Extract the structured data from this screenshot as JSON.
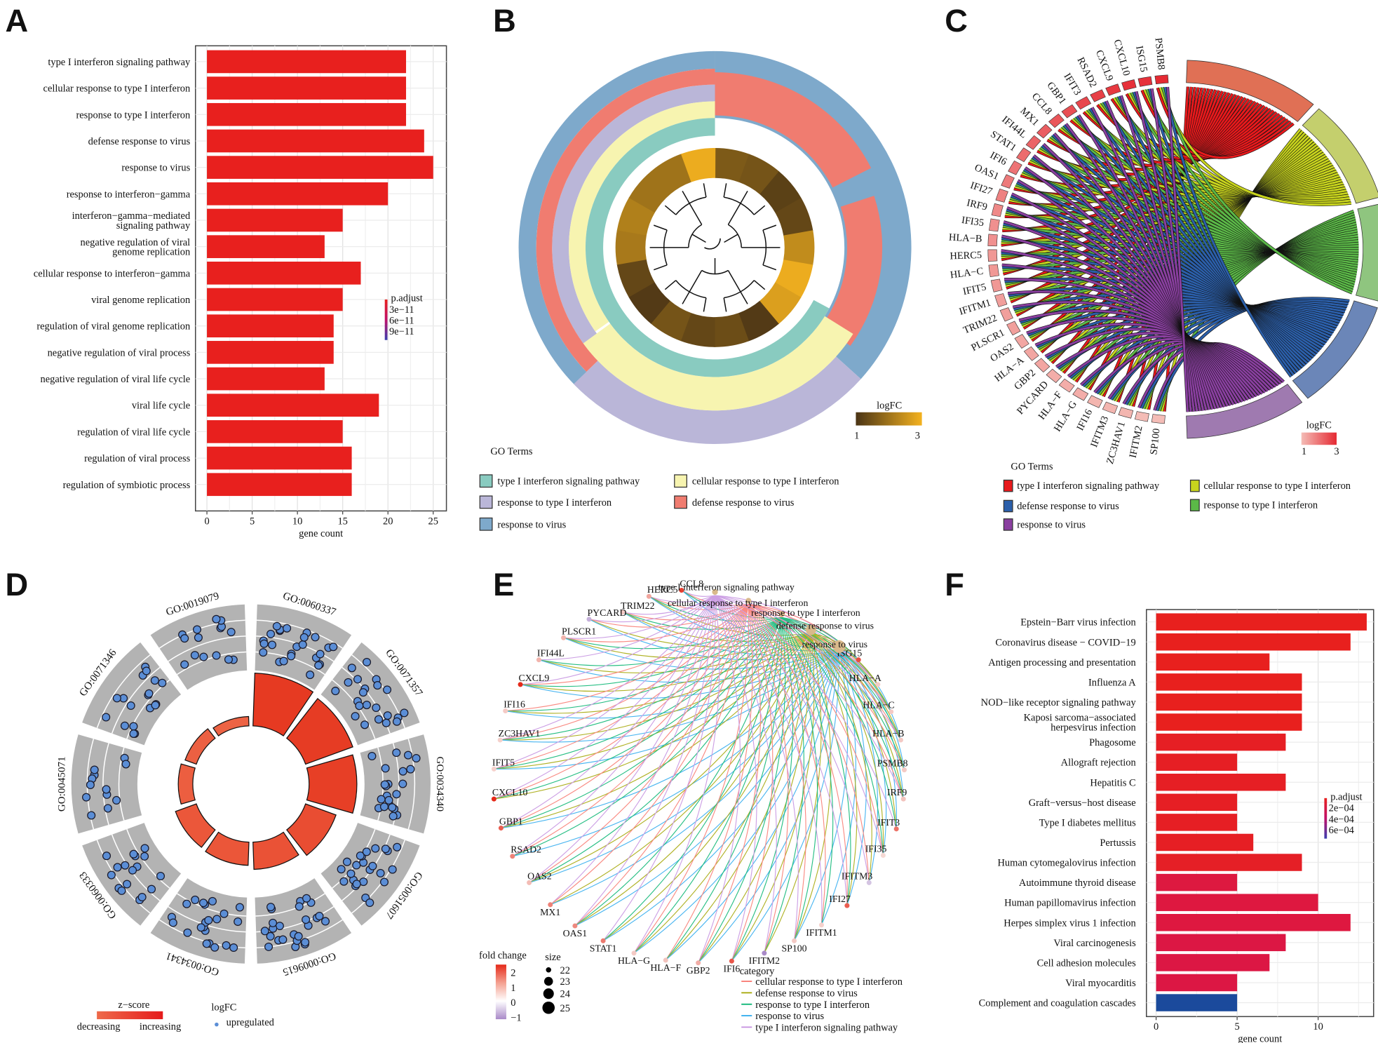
{
  "figure": {
    "panel_labels": [
      "A",
      "B",
      "C",
      "D",
      "E",
      "F"
    ]
  },
  "chart_data": [
    {
      "panel": "A",
      "type": "bar",
      "orientation": "horizontal",
      "categories": [
        "type I interferon signaling pathway",
        "cellular response to type I interferon",
        "response to type I interferon",
        "defense response to virus",
        "response to virus",
        "response to interferon−gamma",
        "interferon−gamma−mediated\nsignaling pathway",
        "negative regulation of viral\ngenome replication",
        "cellular response to interferon−gamma",
        "viral genome replication",
        "regulation of viral genome replication",
        "negative regulation of viral process",
        "negative regulation of viral life cycle",
        "viral life cycle",
        "regulation of viral life cycle",
        "regulation of viral process",
        "regulation of symbiotic process"
      ],
      "values": [
        22,
        22,
        22,
        24,
        25,
        20,
        15,
        13,
        17,
        15,
        14,
        14,
        13,
        19,
        15,
        16,
        16
      ],
      "bar_colors": [
        "#e8201e"
      ],
      "xlabel": "gene count",
      "xlim": [
        0,
        26
      ],
      "xticks": [
        "0",
        "5",
        "10",
        "15",
        "20",
        "25"
      ],
      "grid": true,
      "legend": {
        "title": "p.adjust",
        "labels": [
          "3e−11",
          "6e−11",
          "9e−11"
        ],
        "low_color": "#e8201e",
        "high_color": "#3a3fb0",
        "placement": "right"
      }
    },
    {
      "panel": "B",
      "type": "heatmap",
      "legend_title": "GO Terms",
      "terms": [
        {
          "name": "type I interferon signaling pathway",
          "color": "#89cbc0"
        },
        {
          "name": "cellular response to type I interferon",
          "color": "#f7f4b0"
        },
        {
          "name": "response to type I interferon",
          "color": "#bab6d8"
        },
        {
          "name": "defense response to virus",
          "color": "#f07c70"
        },
        {
          "name": "response to virus",
          "color": "#7ea9cb"
        }
      ],
      "colorbar": {
        "title": "logFC",
        "min_label": "1",
        "max_label": "3",
        "low_color": "#4a3415",
        "high_color": "#f4b21f"
      },
      "logfc_ring": [
        1.6,
        1.5,
        1.2,
        1.3,
        2.4,
        2.9,
        2.7,
        1.1,
        1.4,
        1.3,
        1.5,
        1.1,
        1.3,
        2.1,
        2.2,
        2.0,
        2.0,
        2.9
      ]
    },
    {
      "panel": "C",
      "type": "chord",
      "genes": [
        {
          "name": "SP100",
          "logfc": 1.0
        },
        {
          "name": "IFITM2",
          "logfc": 1.0
        },
        {
          "name": "ZC3HAV1",
          "logfc": 1.1
        },
        {
          "name": "IFITM3",
          "logfc": 1.1
        },
        {
          "name": "IFI16",
          "logfc": 1.1
        },
        {
          "name": "HLA−G",
          "logfc": 1.2
        },
        {
          "name": "HLA−F",
          "logfc": 1.2
        },
        {
          "name": "PYCARD",
          "logfc": 1.2
        },
        {
          "name": "GBP2",
          "logfc": 1.3
        },
        {
          "name": "HLA−A",
          "logfc": 1.3
        },
        {
          "name": "OAS2",
          "logfc": 1.3
        },
        {
          "name": "PLSCR1",
          "logfc": 1.4
        },
        {
          "name": "TRIM22",
          "logfc": 1.4
        },
        {
          "name": "IFITM1",
          "logfc": 1.4
        },
        {
          "name": "IFIT5",
          "logfc": 1.5
        },
        {
          "name": "HLA−C",
          "logfc": 1.5
        },
        {
          "name": "HERC5",
          "logfc": 1.5
        },
        {
          "name": "HLA−B",
          "logfc": 1.6
        },
        {
          "name": "IFI35",
          "logfc": 1.6
        },
        {
          "name": "IRF9",
          "logfc": 1.7
        },
        {
          "name": "IFI27",
          "logfc": 1.8
        },
        {
          "name": "OAS1",
          "logfc": 1.9
        },
        {
          "name": "IFI6",
          "logfc": 2.0
        },
        {
          "name": "STAT1",
          "logfc": 2.1
        },
        {
          "name": "IFI44L",
          "logfc": 2.2
        },
        {
          "name": "MX1",
          "logfc": 2.3
        },
        {
          "name": "CCL8",
          "logfc": 2.4
        },
        {
          "name": "GBP1",
          "logfc": 2.5
        },
        {
          "name": "IFIT3",
          "logfc": 2.6
        },
        {
          "name": "RSAD2",
          "logfc": 2.7
        },
        {
          "name": "CXCL9",
          "logfc": 2.8
        },
        {
          "name": "CXCL10",
          "logfc": 2.9
        },
        {
          "name": "ISG15",
          "logfc": 2.9
        },
        {
          "name": "PSMB8",
          "logfc": 3.0
        }
      ],
      "terms": [
        {
          "name": "type I interferon signaling pathway",
          "color": "#e8191c",
          "band_color": "#e07055"
        },
        {
          "name": "cellular response to type I interferon",
          "color": "#c8d41d",
          "band_color": "#c4cf6d"
        },
        {
          "name": "response to type I interferon",
          "color": "#5bb947",
          "band_color": "#8fc57f"
        },
        {
          "name": "defense response to virus",
          "color": "#2b5faa",
          "band_color": "#6b86b8"
        },
        {
          "name": "response to virus",
          "color": "#8a3fa0",
          "band_color": "#9f7ab0"
        }
      ],
      "legend_title": "GO Terms",
      "colorbar": {
        "title": "logFC",
        "min_label": "1",
        "max_label": "3",
        "low_color": "#f4bcb6",
        "high_color": "#e52a33"
      }
    },
    {
      "panel": "D",
      "type": "bar",
      "layout": "circular",
      "terms": [
        {
          "id": "GO:0060337",
          "bar_fraction": 1.0,
          "dots": 25
        },
        {
          "id": "GO:0071357",
          "bar_fraction": 0.95,
          "dots": 22
        },
        {
          "id": "GO:0034340",
          "bar_fraction": 0.9,
          "dots": 22
        },
        {
          "id": "GO:0051607",
          "bar_fraction": 0.6,
          "dots": 24
        },
        {
          "id": "GO:0009615",
          "bar_fraction": 0.5,
          "dots": 25
        },
        {
          "id": "GO:0034341",
          "bar_fraction": 0.42,
          "dots": 22
        },
        {
          "id": "GO:0060333",
          "bar_fraction": 0.4,
          "dots": 17
        },
        {
          "id": "GO:0045071",
          "bar_fraction": 0.25,
          "dots": 12
        },
        {
          "id": "GO:0071346",
          "bar_fraction": 0.2,
          "dots": 18
        },
        {
          "id": "GO:0019079",
          "bar_fraction": 0.15,
          "dots": 15
        }
      ],
      "zscore_legend": {
        "title": "z−score",
        "low_label": "decreasing",
        "high_label": "increasing",
        "low_color": "#ee6a4a",
        "high_color": "#e51b1b"
      },
      "logfc_legend": {
        "title": "logFC",
        "label": "upregulated",
        "color": "#5b8ed6"
      }
    },
    {
      "panel": "E",
      "type": "network",
      "genes": [
        {
          "name": "HERC5",
          "fc": 0.8
        },
        {
          "name": "CCL8",
          "fc": 2.2
        },
        {
          "name": "TRIM22",
          "fc": 0.3
        },
        {
          "name": "PYCARD",
          "fc": -0.6
        },
        {
          "name": "PLSCR1",
          "fc": 0.6
        },
        {
          "name": "IFI44L",
          "fc": 0.6
        },
        {
          "name": "CXCL9",
          "fc": 2.5
        },
        {
          "name": "IFI16",
          "fc": 0.3
        },
        {
          "name": "ZC3HAV1",
          "fc": 0.2
        },
        {
          "name": "IFIT5",
          "fc": 0.2
        },
        {
          "name": "CXCL10",
          "fc": 2.5
        },
        {
          "name": "GBP1",
          "fc": 1.8
        },
        {
          "name": "RSAD2",
          "fc": 1.3
        },
        {
          "name": "OAS2",
          "fc": 0.5
        },
        {
          "name": "MX1",
          "fc": 1.3
        },
        {
          "name": "OAS1",
          "fc": 1.2
        },
        {
          "name": "STAT1",
          "fc": 1.4
        },
        {
          "name": "HLA−G",
          "fc": 0.3
        },
        {
          "name": "HLA−F",
          "fc": 0.4
        },
        {
          "name": "GBP2",
          "fc": 0.7
        },
        {
          "name": "IFI6",
          "fc": 1.9
        },
        {
          "name": "IFITM2",
          "fc": -1.0
        },
        {
          "name": "SP100",
          "fc": 0.3
        },
        {
          "name": "IFITM1",
          "fc": 0.2
        },
        {
          "name": "IFI27",
          "fc": 1.8
        },
        {
          "name": "IFITM3",
          "fc": -0.4
        },
        {
          "name": "IFI35",
          "fc": 0.1
        },
        {
          "name": "IFIT3",
          "fc": 1.5
        },
        {
          "name": "IRF9",
          "fc": 0.4
        },
        {
          "name": "PSMB8",
          "fc": 0.3
        },
        {
          "name": "HLA−B",
          "fc": 0.3
        },
        {
          "name": "HLA−C",
          "fc": 0.3
        },
        {
          "name": "HLA−A",
          "fc": 0.3
        },
        {
          "name": "ISG15",
          "fc": 2.0
        }
      ],
      "terms": [
        {
          "name": "type I interferon signaling pathway",
          "size": 22,
          "edge_color": "#c48fe0"
        },
        {
          "name": "cellular response to type I interferon",
          "size": 22,
          "edge_color": "#f8766d"
        },
        {
          "name": "response to type I interferon",
          "size": 22,
          "edge_color": "#00b36e"
        },
        {
          "name": "defense response to virus",
          "size": 24,
          "edge_color": "#a3a500"
        },
        {
          "name": "response to virus",
          "size": 25,
          "edge_color": "#2aa9ee"
        }
      ],
      "term_node_color": "#d9b98b",
      "fold_change_legend": {
        "title": "fold change",
        "ticks": [
          "2",
          "1",
          "0",
          "−1"
        ],
        "high_color": "#e52a1a",
        "mid_color": "#ffffff",
        "low_color": "#a98ac8"
      },
      "size_legend": {
        "title": "size",
        "values": [
          "22",
          "23",
          "24",
          "25"
        ]
      },
      "category_legend": {
        "title": "category",
        "items": [
          {
            "name": "cellular response to type I interferon",
            "color": "#f8766d"
          },
          {
            "name": "defense response to virus",
            "color": "#a3a500"
          },
          {
            "name": "response to type I interferon",
            "color": "#00b36e"
          },
          {
            "name": "response to virus",
            "color": "#2aa9ee"
          },
          {
            "name": "type I interferon signaling pathway",
            "color": "#c48fe0"
          }
        ]
      }
    },
    {
      "panel": "F",
      "type": "bar",
      "orientation": "horizontal",
      "categories": [
        "Epstein−Barr virus infection",
        "Coronavirus disease − COVID−19",
        "Antigen processing and presentation",
        "Influenza A",
        "NOD−like receptor signaling pathway",
        "Kaposi sarcoma−associated\nherpesvirus infection",
        "Phagosome",
        "Allograft rejection",
        "Hepatitis C",
        "Graft−versus−host disease",
        "Type I diabetes mellitus",
        "Pertussis",
        "Human cytomegalovirus infection",
        "Autoimmune thyroid disease",
        "Human papillomavirus infection",
        "Herpes simplex virus 1 infection",
        "Viral carcinogenesis",
        "Cell adhesion molecules",
        "Viral myocarditis",
        "Complement and coagulation cascades"
      ],
      "values": [
        13,
        12,
        7,
        9,
        9,
        9,
        8,
        5,
        8,
        5,
        5,
        6,
        9,
        5,
        10,
        12,
        8,
        7,
        5,
        5
      ],
      "bar_colors": [
        "#e8201e",
        "#e8201e",
        "#e8201e",
        "#e8201e",
        "#e8201e",
        "#e8201e",
        "#e61f24",
        "#e61f24",
        "#e61f24",
        "#e61f24",
        "#e61f24",
        "#e61f24",
        "#e51f26",
        "#dd1940",
        "#de1840",
        "#de1840",
        "#dc1744",
        "#dc1744",
        "#dc1744",
        "#1b4a9c"
      ],
      "xlabel": "gene count",
      "xlim": [
        0,
        13.4
      ],
      "xticks": [
        "0",
        "5",
        "10"
      ],
      "grid": true,
      "legend": {
        "title": "p.adjust",
        "labels": [
          "2e−04",
          "4e−04",
          "6e−04"
        ],
        "low_color": "#e8201e",
        "high_color": "#3a3fb0",
        "placement": "right"
      }
    }
  ]
}
